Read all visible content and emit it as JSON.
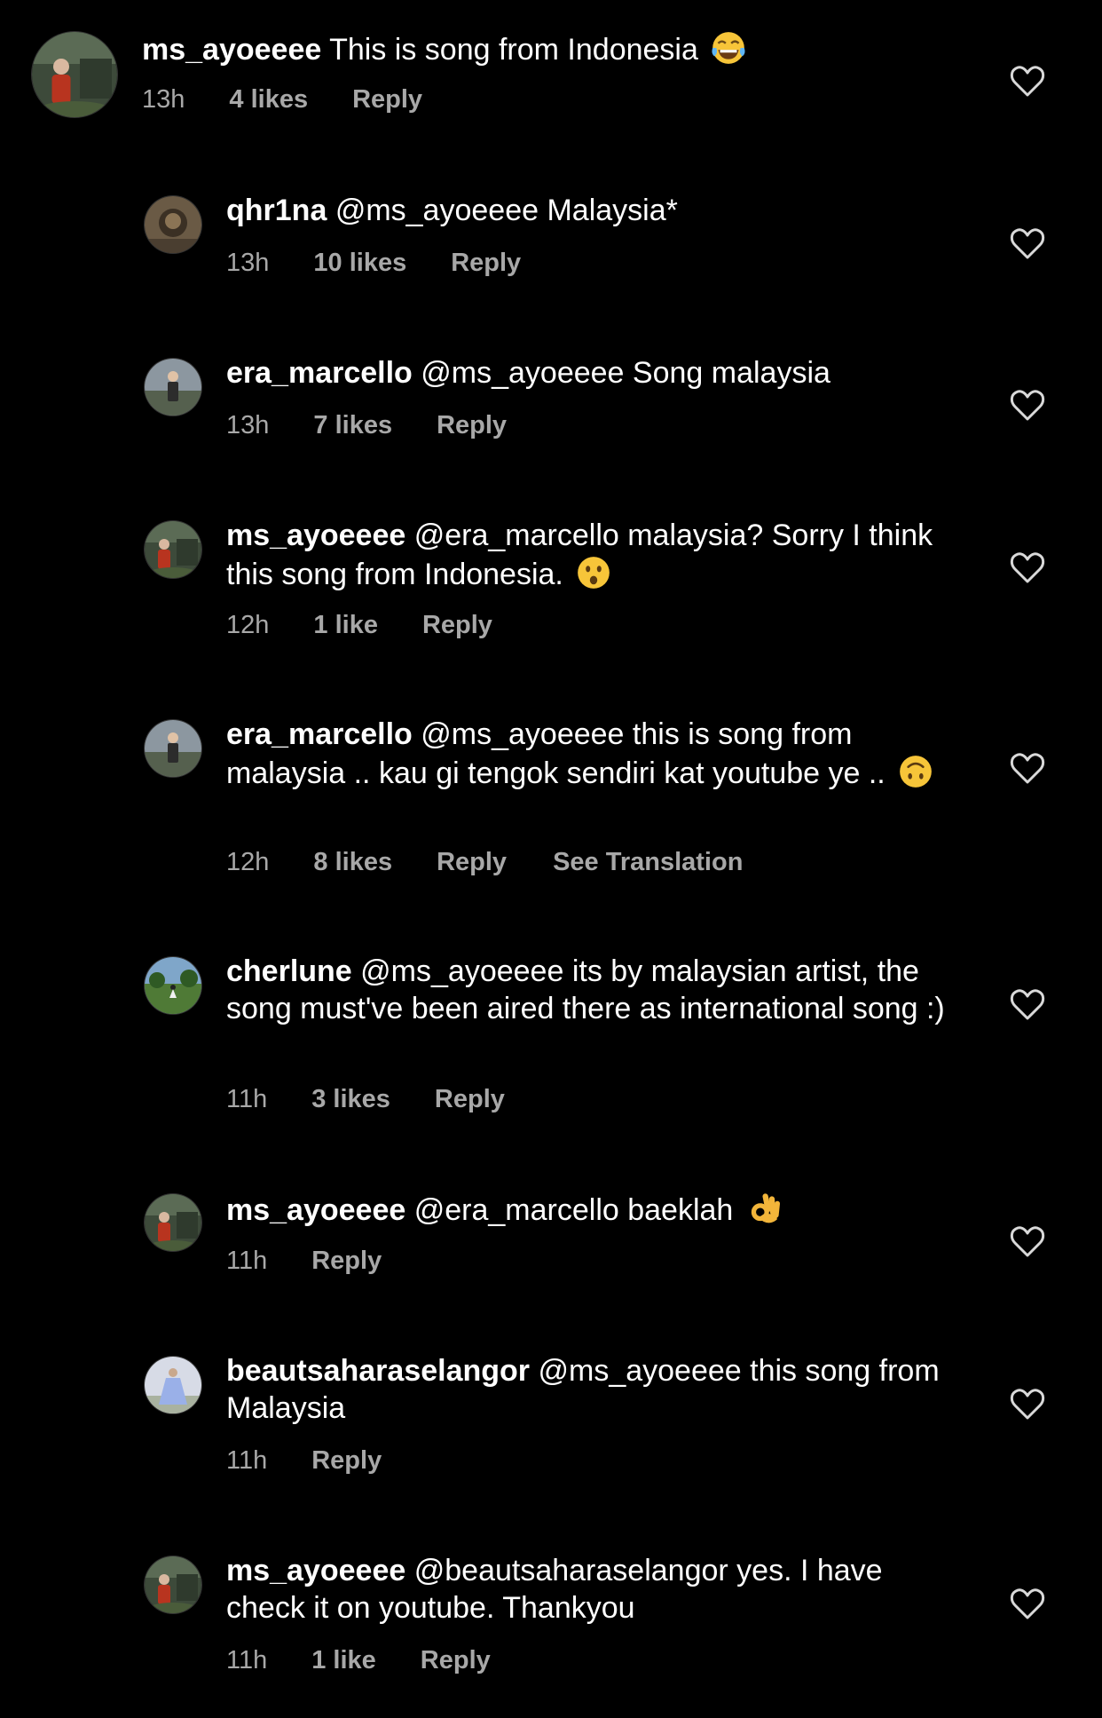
{
  "colors": {
    "background": "#000000",
    "text": "#ffffff",
    "meta": "#a8a8a8"
  },
  "comments": [
    {
      "username": "ms_ayoeeee",
      "text": "This is song from Indonesia",
      "emoji": "tears-of-joy-emoji",
      "time": "13h",
      "likes": "4 likes",
      "reply": "Reply"
    },
    {
      "username": "qhr1na",
      "text": "@ms_ayoeeee Malaysia*",
      "time": "13h",
      "likes": "10 likes",
      "reply": "Reply"
    },
    {
      "username": "era_marcello",
      "text": "@ms_ayoeeee Song malaysia",
      "time": "13h",
      "likes": "7 likes",
      "reply": "Reply"
    },
    {
      "username": "ms_ayoeeee",
      "text": "@era_marcello malaysia? Sorry I think this song from Indonesia.",
      "emoji": "hushed-face-emoji",
      "time": "12h",
      "likes": "1 like",
      "reply": "Reply"
    },
    {
      "username": "era_marcello",
      "text": "@ms_ayoeeee this is song from malaysia .. kau gi tengok sendiri kat youtube ye ..",
      "emoji": "upside-down-face-emoji",
      "time": "12h",
      "likes": "8 likes",
      "reply": "Reply",
      "translate": "See Translation"
    },
    {
      "username": "cherlune",
      "text": "@ms_ayoeeee its by malaysian artist, the song must've been aired there as international song :)",
      "time": "11h",
      "likes": "3 likes",
      "reply": "Reply"
    },
    {
      "username": "ms_ayoeeee",
      "text": "@era_marcello baeklah",
      "emoji": "ok-hand-emoji",
      "time": "11h",
      "reply": "Reply"
    },
    {
      "username": "beautsaharaselangor",
      "text": "@ms_ayoeeee this song from Malaysia",
      "time": "11h",
      "reply": "Reply"
    },
    {
      "username": "ms_ayoeeee",
      "text": "@beautsaharaselangor yes. I have check it on youtube. Thankyou",
      "time": "11h",
      "likes": "1 like",
      "reply": "Reply"
    }
  ]
}
